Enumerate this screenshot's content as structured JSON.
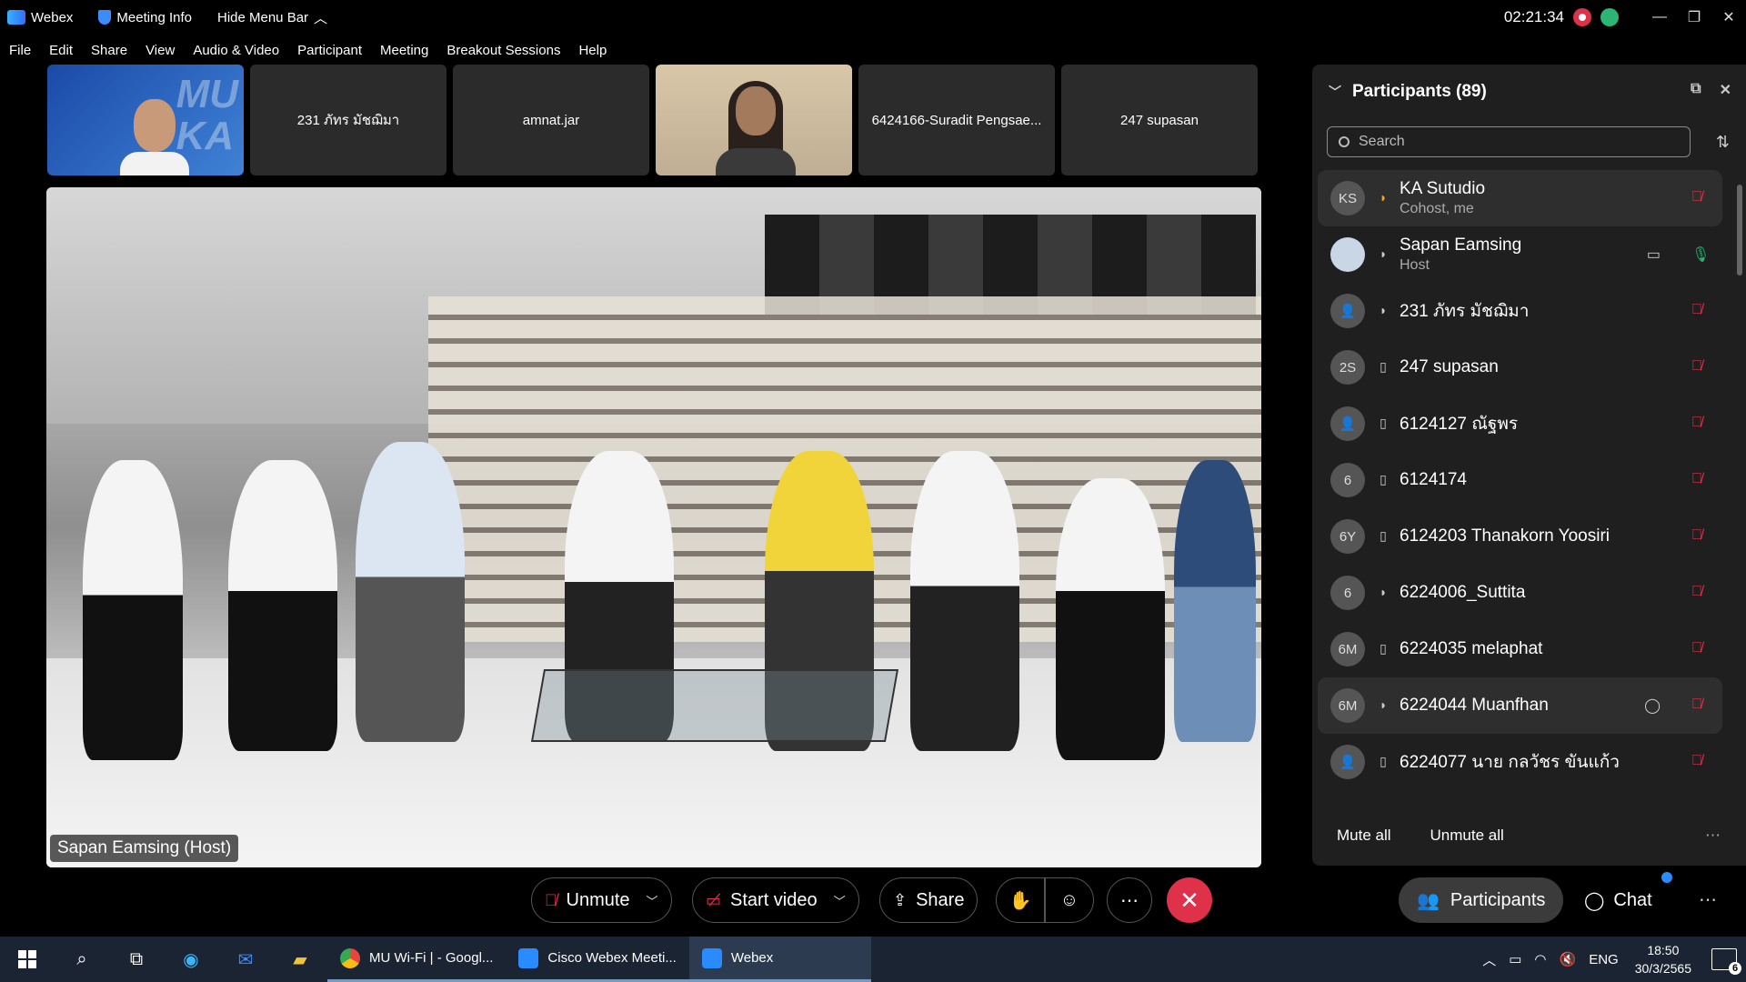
{
  "app": {
    "title": "Webex",
    "meeting_info": "Meeting Info",
    "hide_menu": "Hide Menu Bar",
    "clock": "02:21:34"
  },
  "menu": [
    "File",
    "Edit",
    "Share",
    "View",
    "Audio & Video",
    "Participant",
    "Meeting",
    "Breakout Sessions",
    "Help"
  ],
  "thumbnails": [
    {
      "name": "",
      "type": "video"
    },
    {
      "name": "231 ภัทร มัชฌิมา",
      "type": "name"
    },
    {
      "name": "amnat.jar",
      "type": "name"
    },
    {
      "name": "",
      "type": "video"
    },
    {
      "name": "6424166-Suradit Pengsae...",
      "type": "name"
    },
    {
      "name": "247 supasan",
      "type": "name"
    }
  ],
  "main_video": {
    "speaker_label": "Sapan Eamsing (Host)"
  },
  "participants_panel": {
    "title": "Participants (89)",
    "search_placeholder": "Search",
    "mute_all": "Mute all",
    "unmute_all": "Unmute all",
    "items": [
      {
        "initials": "KS",
        "name": "KA Sutudio",
        "role": "Cohost, me",
        "conn": "computer",
        "mic": "muted",
        "active": true
      },
      {
        "initials": "",
        "name": "Sapan Eamsing",
        "role": "Host",
        "conn": "computer",
        "mic": "on",
        "video": true
      },
      {
        "initials": "",
        "name": "231 ภัทร มัชฌิมา",
        "role": "",
        "conn": "computer",
        "mic": "muted"
      },
      {
        "initials": "2S",
        "name": "247 supasan",
        "role": "",
        "conn": "mobile",
        "mic": "muted"
      },
      {
        "initials": "",
        "name": "6124127 ณัฐพร",
        "role": "",
        "conn": "mobile",
        "mic": "muted"
      },
      {
        "initials": "6",
        "name": "6124174",
        "role": "",
        "conn": "mobile",
        "mic": "muted"
      },
      {
        "initials": "6Y",
        "name": "6124203 Thanakorn Yoosiri",
        "role": "",
        "conn": "mobile",
        "mic": "muted"
      },
      {
        "initials": "6",
        "name": "6224006_Suttita",
        "role": "",
        "conn": "computer",
        "mic": "muted"
      },
      {
        "initials": "6M",
        "name": "6224035 melaphat",
        "role": "",
        "conn": "mobile",
        "mic": "muted"
      },
      {
        "initials": "6M",
        "name": "6224044 Muanfhan",
        "role": "",
        "conn": "computer",
        "mic": "muted",
        "active": true,
        "chat": true
      },
      {
        "initials": "",
        "name": "6224077 นาย กลวัชร ขันแก้ว",
        "role": "",
        "conn": "mobile",
        "mic": "muted"
      }
    ]
  },
  "controls": {
    "unmute": "Unmute",
    "start_video": "Start video",
    "share": "Share",
    "participants": "Participants",
    "chat": "Chat"
  },
  "taskbar": {
    "apps": [
      {
        "label": "MU Wi-Fi | - Googl...",
        "color": "#e8453c"
      },
      {
        "label": "Cisco Webex Meeti...",
        "color": "#2a8bff"
      },
      {
        "label": "Webex",
        "color": "#2a8bff"
      }
    ],
    "lang": "ENG",
    "time": "18:50",
    "date": "30/3/2565",
    "notif_count": "6"
  }
}
